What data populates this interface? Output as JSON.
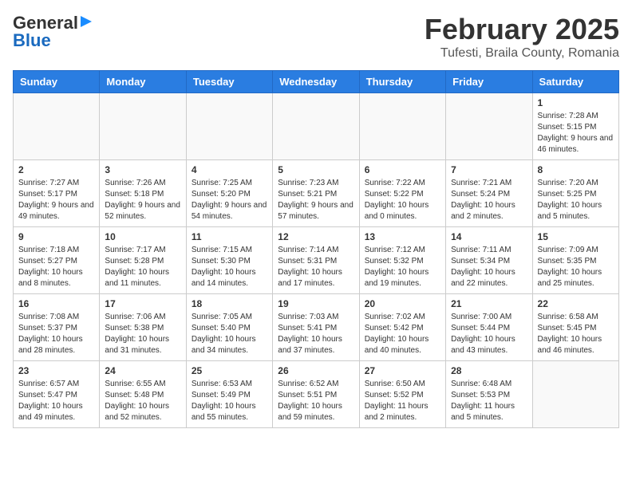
{
  "header": {
    "logo_general": "General",
    "logo_blue": "Blue",
    "title": "February 2025",
    "subtitle": "Tufesti, Braila County, Romania"
  },
  "weekdays": [
    "Sunday",
    "Monday",
    "Tuesday",
    "Wednesday",
    "Thursday",
    "Friday",
    "Saturday"
  ],
  "weeks": [
    [
      {
        "day": "",
        "info": ""
      },
      {
        "day": "",
        "info": ""
      },
      {
        "day": "",
        "info": ""
      },
      {
        "day": "",
        "info": ""
      },
      {
        "day": "",
        "info": ""
      },
      {
        "day": "",
        "info": ""
      },
      {
        "day": "1",
        "info": "Sunrise: 7:28 AM\nSunset: 5:15 PM\nDaylight: 9 hours and 46 minutes."
      }
    ],
    [
      {
        "day": "2",
        "info": "Sunrise: 7:27 AM\nSunset: 5:17 PM\nDaylight: 9 hours and 49 minutes."
      },
      {
        "day": "3",
        "info": "Sunrise: 7:26 AM\nSunset: 5:18 PM\nDaylight: 9 hours and 52 minutes."
      },
      {
        "day": "4",
        "info": "Sunrise: 7:25 AM\nSunset: 5:20 PM\nDaylight: 9 hours and 54 minutes."
      },
      {
        "day": "5",
        "info": "Sunrise: 7:23 AM\nSunset: 5:21 PM\nDaylight: 9 hours and 57 minutes."
      },
      {
        "day": "6",
        "info": "Sunrise: 7:22 AM\nSunset: 5:22 PM\nDaylight: 10 hours and 0 minutes."
      },
      {
        "day": "7",
        "info": "Sunrise: 7:21 AM\nSunset: 5:24 PM\nDaylight: 10 hours and 2 minutes."
      },
      {
        "day": "8",
        "info": "Sunrise: 7:20 AM\nSunset: 5:25 PM\nDaylight: 10 hours and 5 minutes."
      }
    ],
    [
      {
        "day": "9",
        "info": "Sunrise: 7:18 AM\nSunset: 5:27 PM\nDaylight: 10 hours and 8 minutes."
      },
      {
        "day": "10",
        "info": "Sunrise: 7:17 AM\nSunset: 5:28 PM\nDaylight: 10 hours and 11 minutes."
      },
      {
        "day": "11",
        "info": "Sunrise: 7:15 AM\nSunset: 5:30 PM\nDaylight: 10 hours and 14 minutes."
      },
      {
        "day": "12",
        "info": "Sunrise: 7:14 AM\nSunset: 5:31 PM\nDaylight: 10 hours and 17 minutes."
      },
      {
        "day": "13",
        "info": "Sunrise: 7:12 AM\nSunset: 5:32 PM\nDaylight: 10 hours and 19 minutes."
      },
      {
        "day": "14",
        "info": "Sunrise: 7:11 AM\nSunset: 5:34 PM\nDaylight: 10 hours and 22 minutes."
      },
      {
        "day": "15",
        "info": "Sunrise: 7:09 AM\nSunset: 5:35 PM\nDaylight: 10 hours and 25 minutes."
      }
    ],
    [
      {
        "day": "16",
        "info": "Sunrise: 7:08 AM\nSunset: 5:37 PM\nDaylight: 10 hours and 28 minutes."
      },
      {
        "day": "17",
        "info": "Sunrise: 7:06 AM\nSunset: 5:38 PM\nDaylight: 10 hours and 31 minutes."
      },
      {
        "day": "18",
        "info": "Sunrise: 7:05 AM\nSunset: 5:40 PM\nDaylight: 10 hours and 34 minutes."
      },
      {
        "day": "19",
        "info": "Sunrise: 7:03 AM\nSunset: 5:41 PM\nDaylight: 10 hours and 37 minutes."
      },
      {
        "day": "20",
        "info": "Sunrise: 7:02 AM\nSunset: 5:42 PM\nDaylight: 10 hours and 40 minutes."
      },
      {
        "day": "21",
        "info": "Sunrise: 7:00 AM\nSunset: 5:44 PM\nDaylight: 10 hours and 43 minutes."
      },
      {
        "day": "22",
        "info": "Sunrise: 6:58 AM\nSunset: 5:45 PM\nDaylight: 10 hours and 46 minutes."
      }
    ],
    [
      {
        "day": "23",
        "info": "Sunrise: 6:57 AM\nSunset: 5:47 PM\nDaylight: 10 hours and 49 minutes."
      },
      {
        "day": "24",
        "info": "Sunrise: 6:55 AM\nSunset: 5:48 PM\nDaylight: 10 hours and 52 minutes."
      },
      {
        "day": "25",
        "info": "Sunrise: 6:53 AM\nSunset: 5:49 PM\nDaylight: 10 hours and 55 minutes."
      },
      {
        "day": "26",
        "info": "Sunrise: 6:52 AM\nSunset: 5:51 PM\nDaylight: 10 hours and 59 minutes."
      },
      {
        "day": "27",
        "info": "Sunrise: 6:50 AM\nSunset: 5:52 PM\nDaylight: 11 hours and 2 minutes."
      },
      {
        "day": "28",
        "info": "Sunrise: 6:48 AM\nSunset: 5:53 PM\nDaylight: 11 hours and 5 minutes."
      },
      {
        "day": "",
        "info": ""
      }
    ]
  ]
}
